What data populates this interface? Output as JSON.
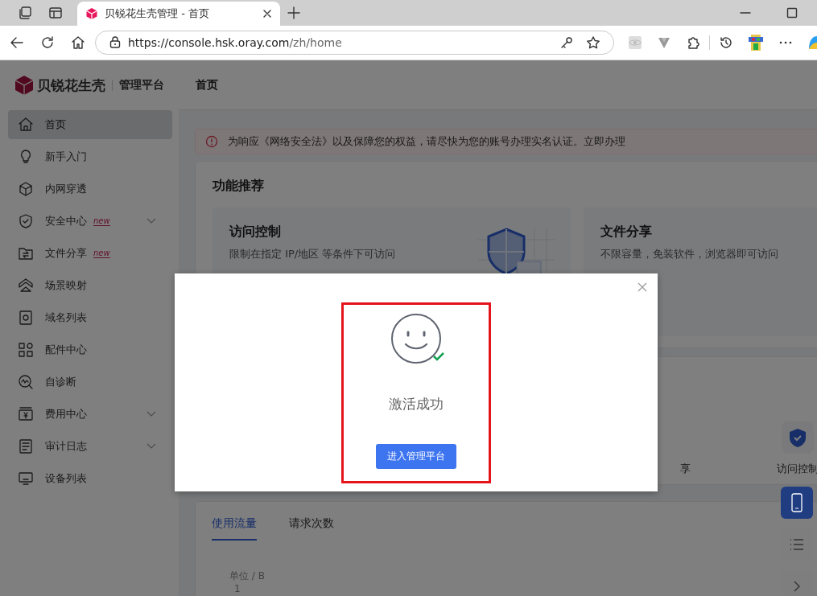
{
  "browser": {
    "tabs": [
      {
        "title": "贝锐花生壳管理 - 首页",
        "selected": true
      }
    ],
    "url": {
      "host": "https://console.hsk.oray.com",
      "path": "/zh/home"
    }
  },
  "sidebar": {
    "brand": "贝锐花生壳",
    "product": "管理平台",
    "items": [
      {
        "label": "首页",
        "selected": true,
        "expandable": false
      },
      {
        "label": "新手入门",
        "selected": false,
        "expandable": false
      },
      {
        "label": "内网穿透",
        "selected": false,
        "expandable": false
      },
      {
        "label": "安全中心",
        "selected": false,
        "badge": "new",
        "expandable": true
      },
      {
        "label": "文件分享",
        "selected": false,
        "badge": "new",
        "expandable": false
      },
      {
        "label": "场景映射",
        "selected": false,
        "expandable": false
      },
      {
        "label": "域名列表",
        "selected": false,
        "expandable": false
      },
      {
        "label": "配件中心",
        "selected": false,
        "expandable": false
      },
      {
        "label": "自诊断",
        "selected": false,
        "expandable": false
      },
      {
        "label": "费用中心",
        "selected": false,
        "expandable": true
      },
      {
        "label": "审计日志",
        "selected": false,
        "expandable": true
      },
      {
        "label": "设备列表",
        "selected": false,
        "expandable": false
      }
    ]
  },
  "header": {
    "title": "首页"
  },
  "alert": {
    "text": "为响应《网络安全法》以及保障您的权益，请尽快为您的账号办理实名认证。立即办理"
  },
  "recommend": {
    "title": "功能推荐",
    "cards": [
      {
        "title": "访问控制",
        "lines": [
          "限制在指定 IP/地区 等条件下可访问"
        ]
      },
      {
        "title": "文件分享",
        "lines": [
          "不限容量，免装软件，浏览器即可访问"
        ]
      }
    ]
  },
  "quick": {
    "items": [
      {
        "label": "享"
      },
      {
        "label": "访问控制"
      }
    ]
  },
  "stats": {
    "tabs": [
      {
        "label": "使用流量",
        "selected": true
      },
      {
        "label": "请求次数",
        "selected": false
      }
    ],
    "unit": "单位 / B",
    "ytick": "1"
  },
  "modal": {
    "message": "激活成功",
    "button": "进入管理平台"
  }
}
